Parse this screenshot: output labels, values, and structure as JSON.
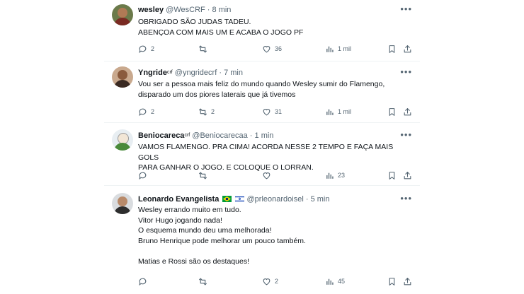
{
  "tweets": [
    {
      "name": "wesley",
      "name_sup": "",
      "handle": "@WesCRF",
      "time": "8 min",
      "text": "OBRIGADO SÃO JUDAS TADEU.\nABENÇOA COM MAIS UM E ACABA O JOGO PF",
      "replies": "2",
      "retweets": "",
      "likes": "36",
      "views": "1 mil"
    },
    {
      "name": "Yngride",
      "name_sup": "crf",
      "handle": "@yngridecrf",
      "time": "7 min",
      "text": "Vou ser a pessoa mais feliz do mundo quando Wesley sumir do Flamengo,\ndisparado um dos piores laterais que já tivemos",
      "replies": "2",
      "retweets": "2",
      "likes": "31",
      "views": "1 mil"
    },
    {
      "name": "Beniocareca",
      "name_sup": "crf",
      "handle": "@Beniocarecaa",
      "time": "1 min",
      "text": "VAMOS FLAMENGO. PRA CIMA! ACORDA NESSE 2 TEMPO E FAÇA MAIS GOLS\nPARA GANHAR O JOGO. E COLOQUE O LORRAN.",
      "replies": "",
      "retweets": "",
      "likes": "",
      "views": "23"
    },
    {
      "name": "Leonardo Evangelista",
      "name_sup": "",
      "handle": "@prleonardoisel",
      "time": "5 min",
      "text": "Wesley errando muito em tudo.\nVitor Hugo jogando nada!\nO esquema mundo deu uma melhorada!\nBruno Henrique pode melhorar um pouco também.\n\nMatias e Rossi são os destaques!",
      "replies": "",
      "retweets": "",
      "likes": "2",
      "views": "45"
    }
  ],
  "separator": "·",
  "colors": {
    "text": "#0f1419",
    "muted": "#536471",
    "divider": "#eff3f4"
  }
}
